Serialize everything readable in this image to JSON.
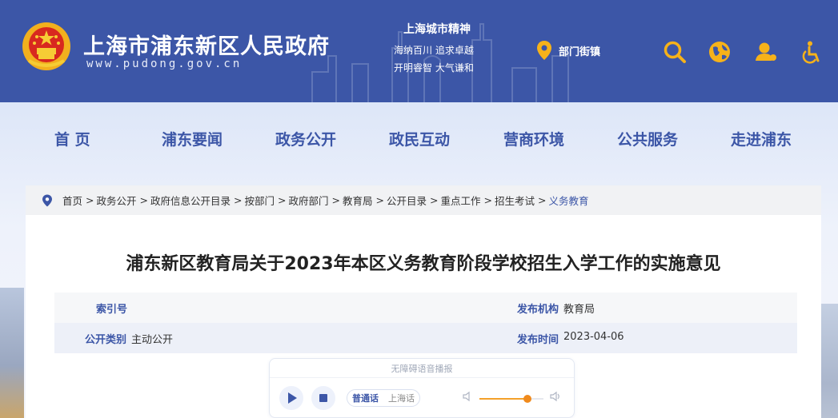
{
  "header": {
    "site_name": "上海市浦东新区人民政府",
    "site_url": "www.pudong.gov.cn",
    "spirit_title": "上海城市精神",
    "spirit_line1": "海纳百川  追求卓越",
    "spirit_line2": "开明睿智  大气谦和",
    "location_label": "部门街镇",
    "icons": [
      "search-icon",
      "globe-icon",
      "user-icon",
      "accessibility-icon"
    ],
    "colors": {
      "brand": "#3c56a7",
      "accent": "#f6b21a"
    }
  },
  "nav": {
    "items": [
      "首  页",
      "浦东要闻",
      "政务公开",
      "政民互动",
      "营商环境",
      "公共服务",
      "走进浦东"
    ]
  },
  "breadcrumb": {
    "items": [
      "首页",
      "政务公开",
      "政府信息公开目录",
      "按部门",
      "政府部门",
      "教育局",
      "公开目录",
      "重点工作",
      "招生考试",
      "义务教育"
    ],
    "separator": ">"
  },
  "document": {
    "title": "浦东新区教育局关于2023年本区义务教育阶段学校招生入学工作的实施意见",
    "meta": {
      "index_label": "索引号",
      "index_value": "",
      "org_label": "发布机构",
      "org_value": "教育局",
      "category_label": "公开类别",
      "category_value": "主动公开",
      "date_label": "发布时间",
      "date_value": "2023-04-06"
    }
  },
  "player": {
    "title": "无障碍语音播报",
    "languages": [
      "普通话",
      "上海话"
    ],
    "active_language": "普通话",
    "volume": 0.75
  }
}
